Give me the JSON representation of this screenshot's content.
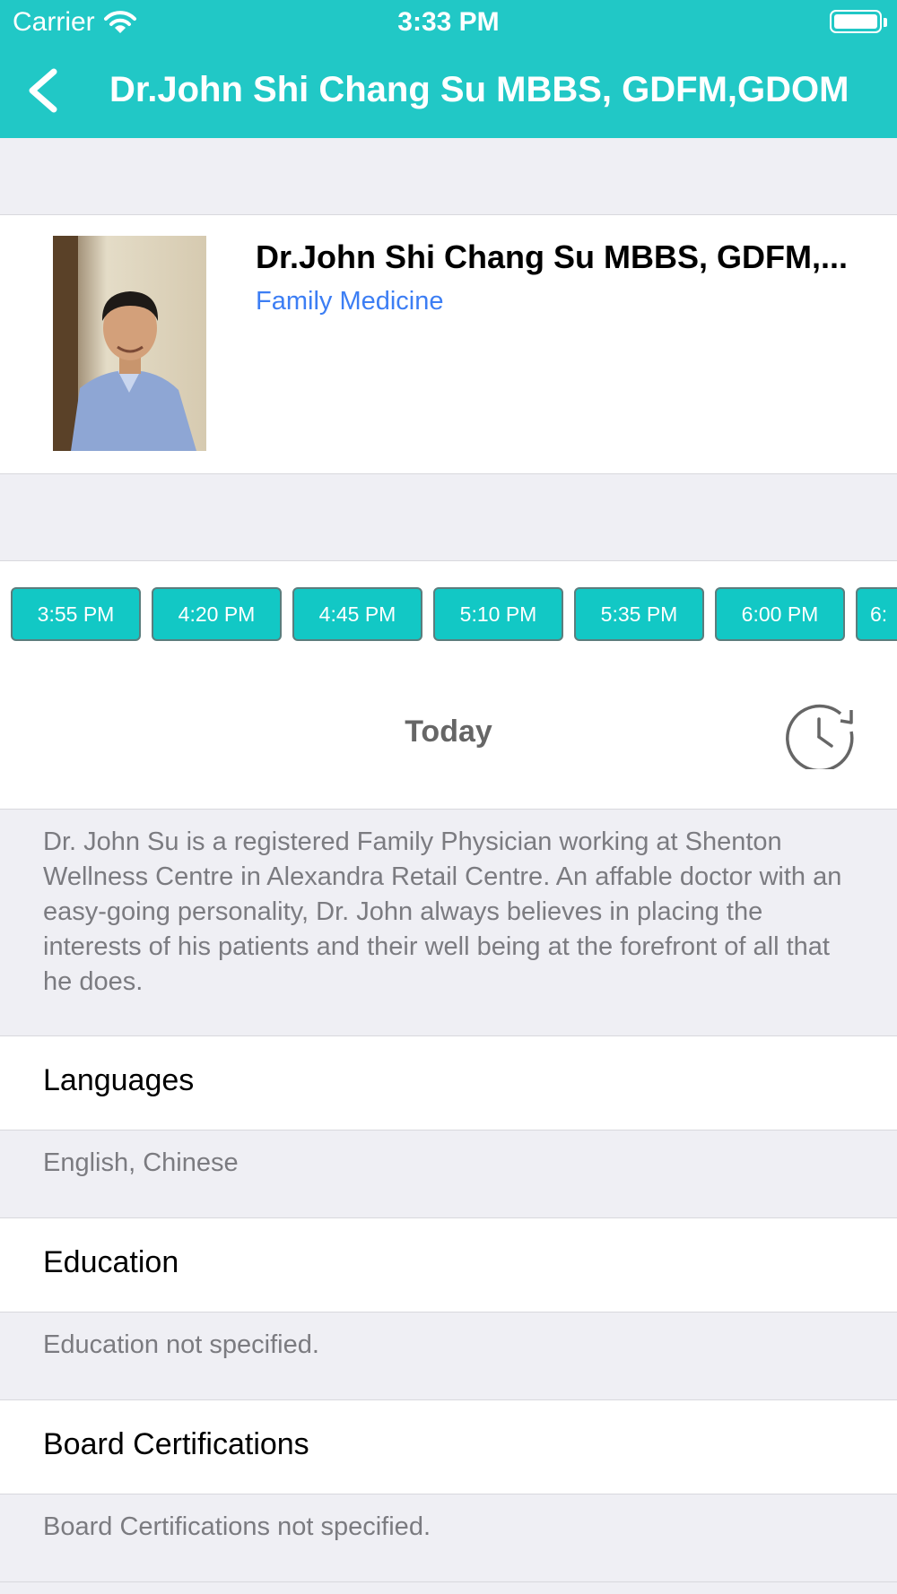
{
  "status_bar": {
    "carrier": "Carrier",
    "time": "3:33 PM"
  },
  "nav": {
    "title": "Dr.John Shi Chang Su MBBS, GDFM,GDOM"
  },
  "doctor": {
    "name": "Dr.John Shi Chang Su MBBS, GDFM,...",
    "specialty": "Family Medicine"
  },
  "time_slots": [
    "3:55 PM",
    "4:20 PM",
    "4:45 PM",
    "5:10 PM",
    "5:35 PM",
    "6:00 PM",
    "6:"
  ],
  "day_label": "Today",
  "bio": "Dr. John Su is a registered Family Physician working at Shenton Wellness Centre in Alexandra Retail Centre.  An affable doctor with an easy-going personality, Dr. John always believes in placing the interests of his patients and their well being at the forefront of all that he does.",
  "sections": {
    "languages": {
      "title": "Languages",
      "value": "English, Chinese"
    },
    "education": {
      "title": "Education",
      "value": "Education not specified."
    },
    "board": {
      "title": "Board Certifications",
      "value": "Board Certifications not specified."
    }
  },
  "colors": {
    "accent": "#21c8c6",
    "slot": "#12c8c5",
    "link": "#3c7ef4"
  },
  "icons": [
    "wifi-icon",
    "battery-icon",
    "back-chevron-icon",
    "clock-refresh-icon"
  ]
}
